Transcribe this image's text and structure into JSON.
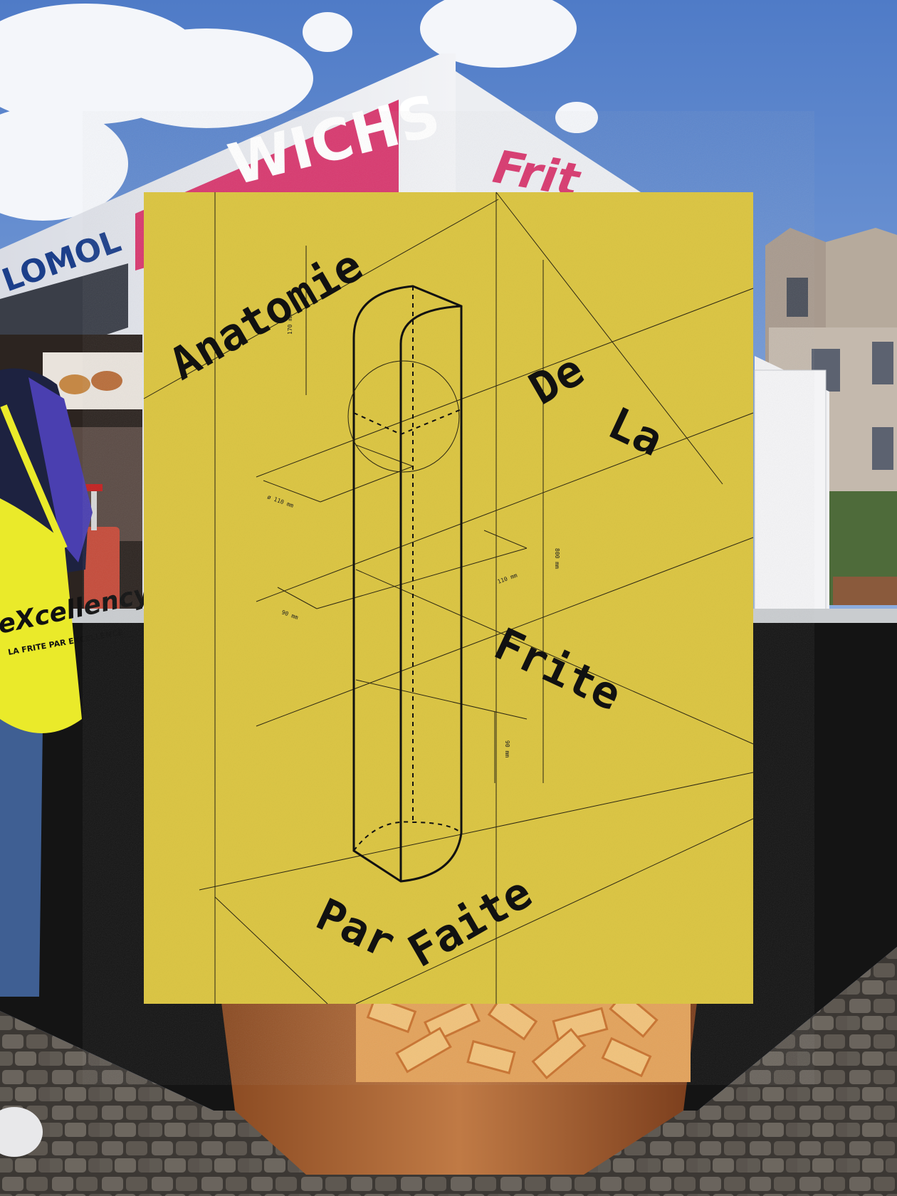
{
  "poster": {
    "words": [
      "Anatomie",
      "De",
      "La",
      "Frite",
      "Par",
      "Faite"
    ],
    "dimensions": [
      "170 mm",
      "ø 110 mm",
      "110 mm",
      "90 mm",
      "800 mm",
      "90 mm"
    ],
    "color": "#dcc645"
  },
  "truck_sign": {
    "left_text": "WICHS",
    "far_left_text": "LOMOL",
    "right_text": "Frit"
  },
  "tote_bag": {
    "script": "eXcellency",
    "caption": "LA FRITE PAR EXCELLENCE"
  },
  "colors": {
    "sky": "#6f8fc9",
    "poster": "#dcc645",
    "sign_pink": "#d8396f",
    "bag_yellow": "#eaea2a",
    "counter_black": "#141414",
    "cobblestone": "#5a5550"
  }
}
